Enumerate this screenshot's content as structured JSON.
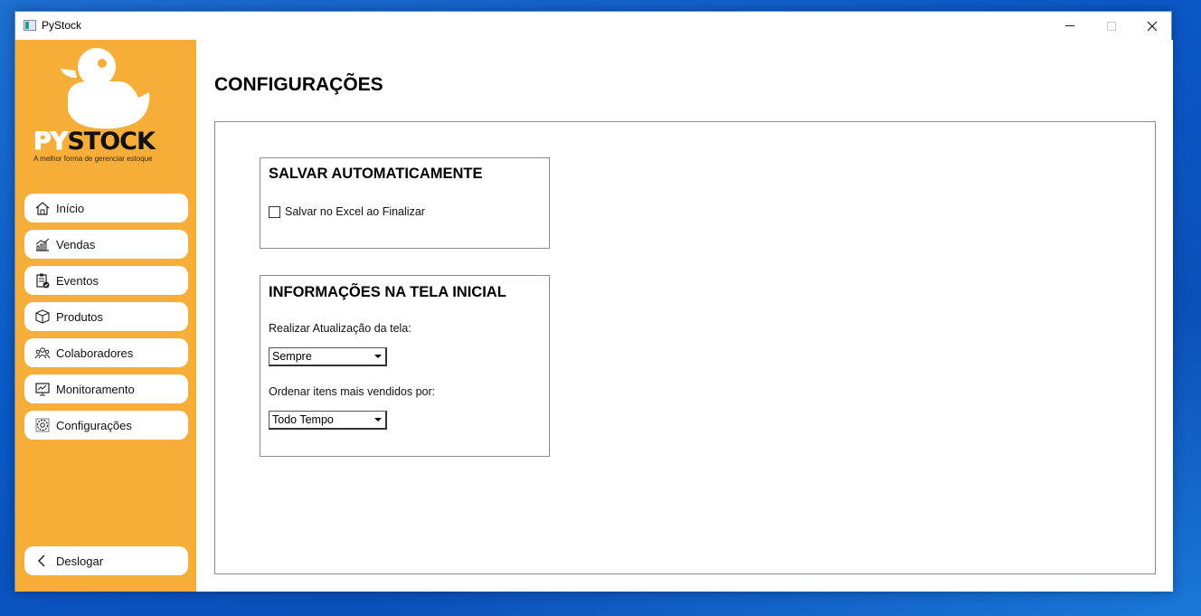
{
  "window": {
    "title": "PyStock"
  },
  "logo": {
    "word_py": "PY",
    "word_stock": "STOCK",
    "tagline": "A melhor forma de gerenciar estoque"
  },
  "sidebar": {
    "items": [
      {
        "label": "Início",
        "icon": "home-icon"
      },
      {
        "label": "Vendas",
        "icon": "sales-chart-icon"
      },
      {
        "label": "Eventos",
        "icon": "clipboard-check-icon"
      },
      {
        "label": "Produtos",
        "icon": "box-icon"
      },
      {
        "label": "Colaboradores",
        "icon": "people-icon"
      },
      {
        "label": "Monitoramento",
        "icon": "monitor-icon"
      },
      {
        "label": "Configurações",
        "icon": "settings-icon"
      }
    ],
    "logout": {
      "label": "Deslogar",
      "icon": "chevron-left-icon"
    }
  },
  "main": {
    "title": "CONFIGURAÇÕES",
    "auto_save": {
      "heading": "SALVAR AUTOMATICAMENTE",
      "checkbox_label": "Salvar no Excel ao Finalizar",
      "checked": false
    },
    "home_info": {
      "heading": "INFORMAÇÕES NA TELA INICIAL",
      "refresh_label": "Realizar Atualização da tela:",
      "refresh_value": "Sempre",
      "order_label": "Ordenar itens mais vendidos por:",
      "order_value": "Todo Tempo"
    }
  },
  "colors": {
    "sidebar_bg": "#f7ae38",
    "window_bg": "#ffffff",
    "desktop_bg": "#0a58c8"
  }
}
